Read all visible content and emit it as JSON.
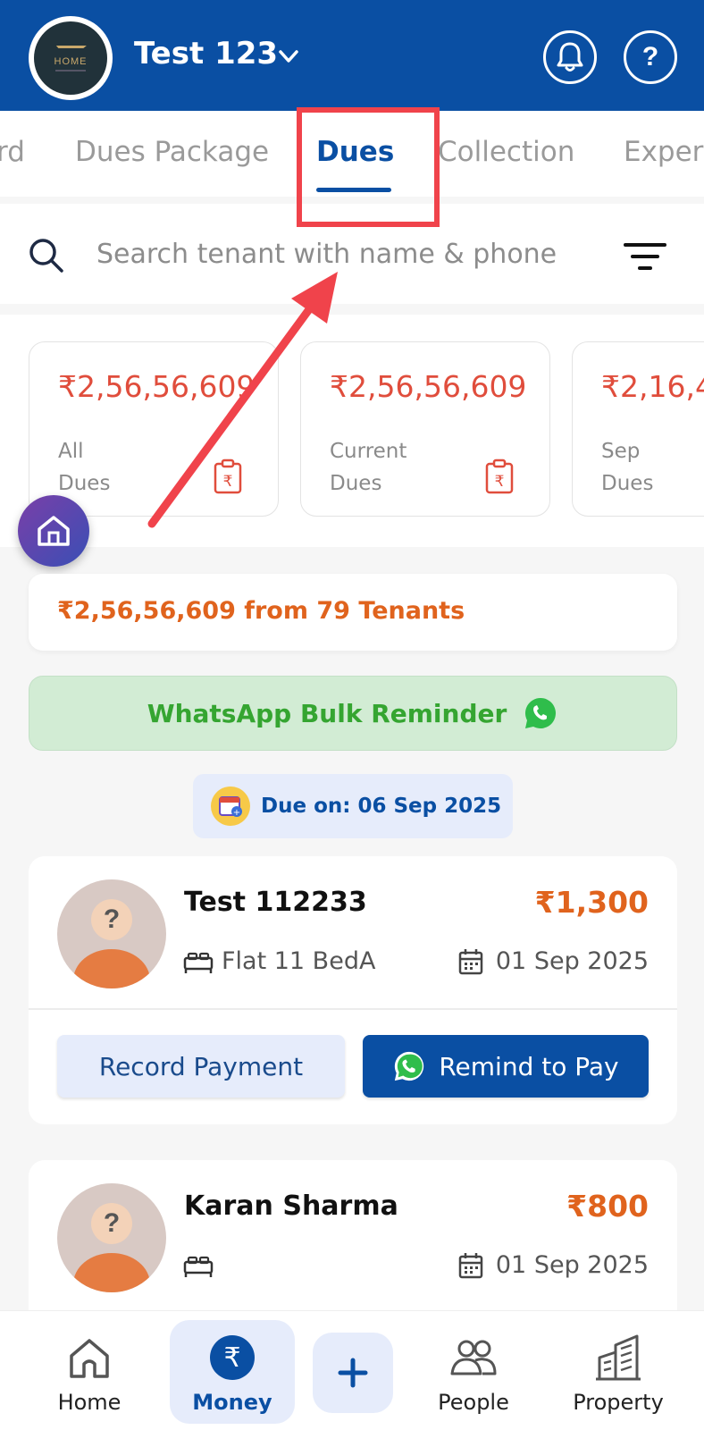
{
  "header": {
    "logo_text": "HOME",
    "property_name": "Test 123",
    "colors": {
      "primary": "#0a4fa3"
    }
  },
  "tabs": [
    {
      "label": "rd"
    },
    {
      "label": "Dues Package"
    },
    {
      "label": "Dues"
    },
    {
      "label": "Collection"
    },
    {
      "label": "Exper"
    }
  ],
  "search": {
    "placeholder": "Search tenant with name & phone",
    "value": ""
  },
  "summary_cards": [
    {
      "amount": "₹2,56,56,609",
      "label_line1": "All",
      "label_line2": "Dues"
    },
    {
      "amount": "₹2,56,56,609",
      "label_line1": "Current",
      "label_line2": "Dues"
    },
    {
      "amount": "₹2,16,4",
      "label_line1": "Sep",
      "label_line2": "Dues"
    }
  ],
  "total_banner": "₹2,56,56,609 from 79 Tenants",
  "whatsapp_bulk_label": "WhatsApp Bulk Reminder",
  "due_on": "Due on: 06 Sep 2025",
  "tenants": [
    {
      "name": "Test 112233",
      "amount": "₹1,300",
      "room": "Flat 11 BedA",
      "date": "01 Sep 2025",
      "record_label": "Record Payment",
      "remind_label": "Remind to Pay"
    },
    {
      "name": "Karan Sharma",
      "amount": "₹800",
      "room": "",
      "date": "01 Sep 2025"
    }
  ],
  "avatar_placeholder": "?",
  "bottom_nav": {
    "home": "Home",
    "money": "Money",
    "people": "People",
    "property": "Property"
  }
}
